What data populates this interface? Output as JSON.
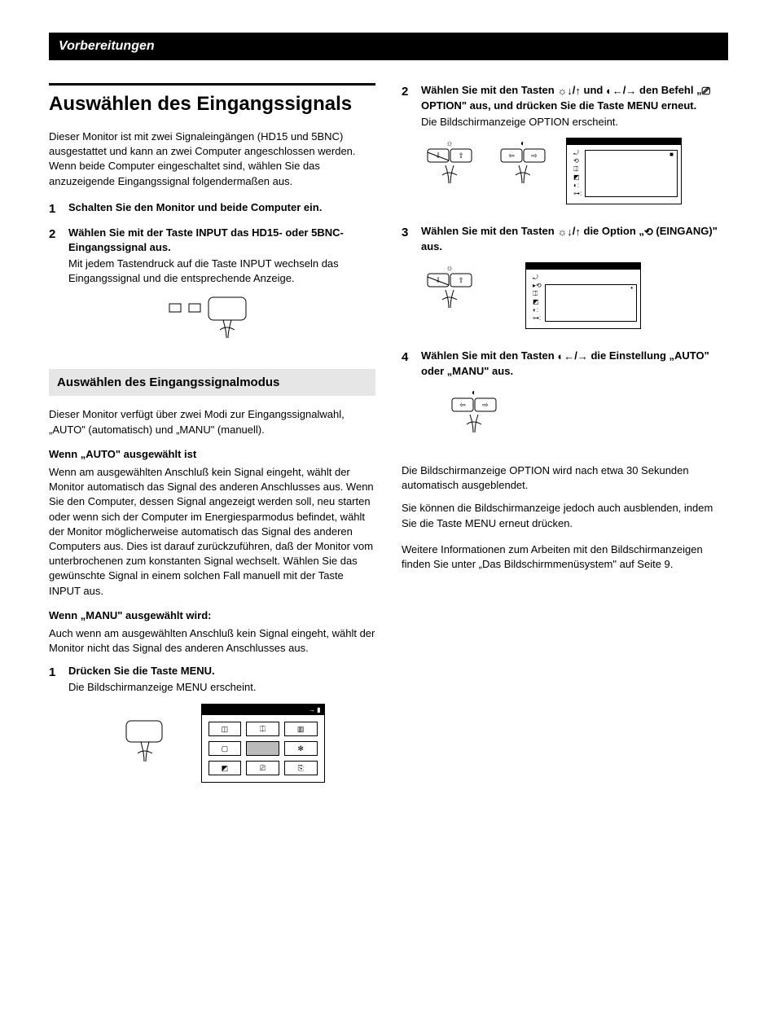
{
  "header": {
    "section": "Vorbereitungen"
  },
  "left": {
    "h1": "Auswählen des Eingangssignals",
    "intro": "Dieser Monitor ist mit zwei Signaleingängen (HD15 und 5BNC) ausgestattet und kann an zwei Computer angeschlossen werden. Wenn beide Computer eingeschaltet sind, wählen Sie das anzuzeigende Eingangssignal folgendermaßen aus.",
    "step1": {
      "num": "1",
      "title": "Schalten Sie den Monitor und beide Computer ein."
    },
    "step2": {
      "num": "2",
      "title": "Wählen Sie mit der Taste INPUT das HD15- oder 5BNC-Eingangssignal aus.",
      "desc": "Mit jedem Tastendruck auf die Taste INPUT wechseln das Eingangssignal und die entsprechende Anzeige."
    },
    "h2": "Auswählen des Eingangssignalmodus",
    "mode_intro": "Dieser Monitor verfügt über zwei Modi zur Eingangssignalwahl, „AUTO\" (automatisch) und „MANU\" (manuell).",
    "auto_h": "Wenn „AUTO\" ausgewählt ist",
    "auto_p": "Wenn am ausgewählten Anschluß kein Signal eingeht, wählt der Monitor automatisch das Signal des anderen Anschlusses aus. Wenn Sie den Computer, dessen Signal angezeigt werden soll, neu starten oder wenn sich der Computer im Energiesparmodus befindet, wählt der Monitor möglicherweise automatisch das Signal des anderen Computers aus. Dies ist darauf zurückzuführen, daß der Monitor vom unterbrochenen zum konstanten Signal wechselt. Wählen Sie das gewünschte Signal in einem solchen Fall manuell mit der Taste INPUT aus.",
    "manu_h": "Wenn „MANU\" ausgewählt wird:",
    "manu_p": "Auch wenn am ausgewählten Anschluß kein Signal eingeht, wählt der Monitor nicht das Signal des anderen Anschlusses aus.",
    "m_step1": {
      "num": "1",
      "title": "Drücken Sie die Taste MENU.",
      "desc": "Die Bildschirmanzeige MENU erscheint."
    },
    "menu_arrow": "→ ▮"
  },
  "right": {
    "step2": {
      "num": "2",
      "title_a": "Wählen Sie mit den Tasten ",
      "title_b": " und ",
      "title_c": " den Befehl „",
      "title_d": " OPTION\" aus, und drücken Sie die Taste MENU erneut.",
      "desc": "Die Bildschirmanzeige OPTION erscheint."
    },
    "step3": {
      "num": "3",
      "title_a": "Wählen Sie mit den Tasten ",
      "title_b": " die Option „",
      "title_c": " (EINGANG)\" aus."
    },
    "step4": {
      "num": "4",
      "title_a": "Wählen Sie mit den Tasten ",
      "title_b": " die Einstellung „AUTO\" oder „MANU\" aus."
    },
    "out_p1": "Die Bildschirmanzeige OPTION wird nach etwa 30 Sekunden automatisch ausgeblendet.",
    "out_p2": "Sie können die Bildschirmanzeige jedoch auch ausblenden, indem Sie die Taste MENU erneut drücken.",
    "out_p3": "Weitere Informationen zum Arbeiten mit den Bildschirmanzeigen finden Sie unter „Das Bildschirmmenüsystem\" auf Seite 9."
  }
}
